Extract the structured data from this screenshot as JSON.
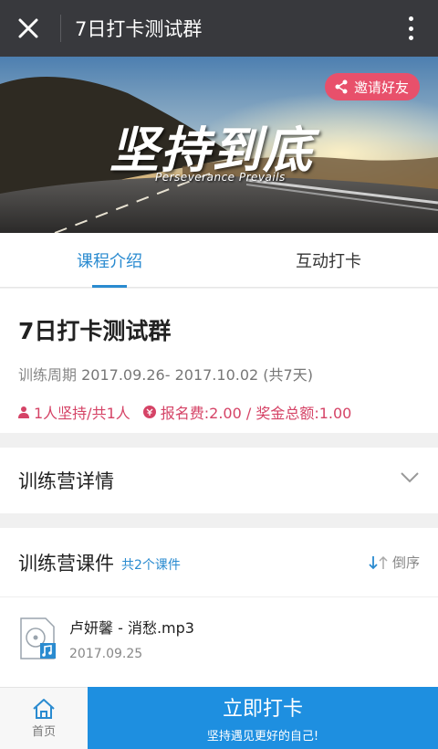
{
  "header": {
    "title": "7日打卡测试群"
  },
  "banner": {
    "invite_label": "邀请好友",
    "title_art": "坚持到底",
    "subtitle_art": "Perseverance Prevails"
  },
  "tabs": [
    {
      "label": "课程介绍",
      "active": true
    },
    {
      "label": "互动打卡",
      "active": false
    }
  ],
  "info": {
    "name": "7日打卡测试群",
    "period_label": "训练周期",
    "period_value": "2017.09.26- 2017.10.02 (共7天)",
    "persistence": "1人坚持/共1人",
    "fee": "报名费:2.00 / 奖金总额:1.00"
  },
  "details": {
    "label": "训练营详情"
  },
  "courses": {
    "title": "训练营课件",
    "count": "共2个课件",
    "sort_label": "倒序",
    "items": [
      {
        "name": "卢妍馨 - 消愁.mp3",
        "date": "2017.09.25"
      }
    ]
  },
  "bottom": {
    "home_label": "首页",
    "checkin_label": "立即打卡",
    "checkin_sub": "坚持遇见更好的自己!"
  },
  "colors": {
    "accent": "#2a8bd0",
    "pink": "#d54366",
    "invite_bg": "#e8506b",
    "topbar": "#38393d",
    "checkin_bg": "#1e8fe0"
  }
}
